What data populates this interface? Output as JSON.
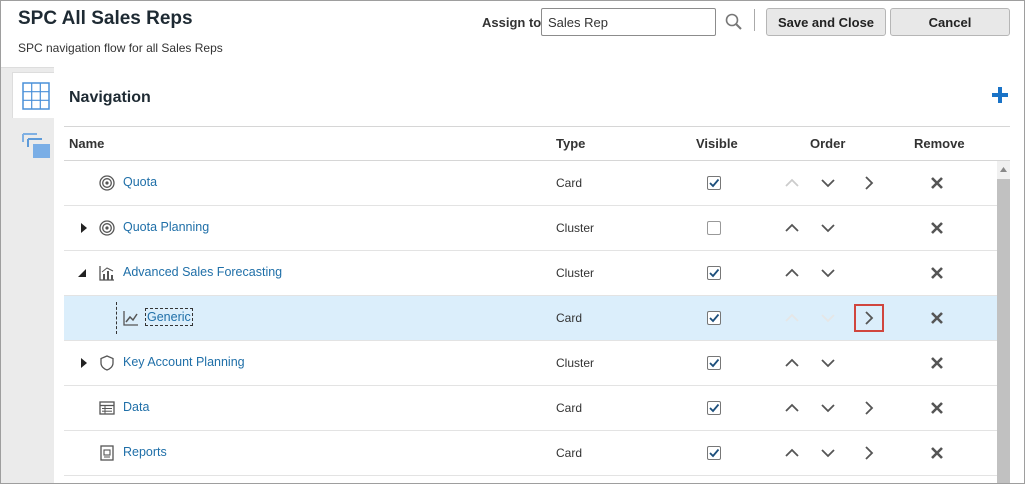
{
  "header": {
    "title": "SPC All Sales Reps",
    "subtitle": "SPC navigation flow for all Sales Reps",
    "assign_label": "Assign to",
    "assign_value": "Sales Rep",
    "save_label": "Save and Close",
    "cancel_label": "Cancel"
  },
  "section_title": "Navigation",
  "columns": {
    "name": "Name",
    "type": "Type",
    "visible": "Visible",
    "order": "Order",
    "remove": "Remove"
  },
  "rows": [
    {
      "name": "Quota",
      "type": "Card",
      "icon": "target-icon",
      "visible": true
    },
    {
      "name": "Quota Planning",
      "type": "Cluster",
      "icon": "target-icon",
      "visible": false,
      "expander": "collapsed"
    },
    {
      "name": "Advanced Sales Forecasting",
      "type": "Cluster",
      "icon": "bar-chart-icon",
      "visible": true,
      "expander": "expanded"
    },
    {
      "name": "Generic",
      "type": "Card",
      "icon": "line-chart-icon",
      "visible": true,
      "selected": true
    },
    {
      "name": "Key Account Planning",
      "type": "Cluster",
      "icon": "shield-icon",
      "visible": true,
      "expander": "collapsed"
    },
    {
      "name": "Data",
      "type": "Card",
      "icon": "table-icon",
      "visible": true
    },
    {
      "name": "Reports",
      "type": "Card",
      "icon": "report-icon",
      "visible": true
    }
  ],
  "colors": {
    "link": "#1f6fa8",
    "selected_row": "#dbeefb",
    "add_icon": "#1a73c7",
    "highlight_border": "#d0453d"
  }
}
